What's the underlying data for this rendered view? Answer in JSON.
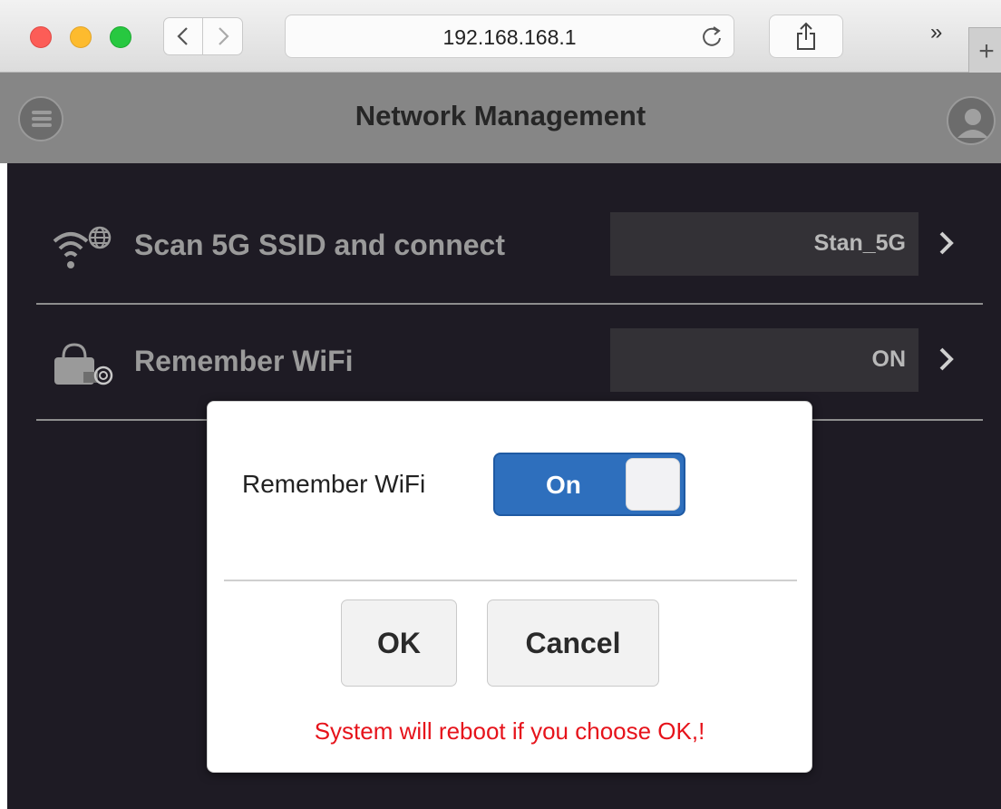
{
  "browser": {
    "url": "192.168.168.1",
    "overflow_label": "»",
    "new_tab_label": "+"
  },
  "app": {
    "title": "Network Management"
  },
  "rows": [
    {
      "label": "Scan 5G SSID and connect",
      "value": "Stan_5G",
      "icon": "wifi-globe-icon"
    },
    {
      "label": "Remember WiFi",
      "value": "ON",
      "icon": "wifi-lock-icon"
    }
  ],
  "dialog": {
    "label": "Remember WiFi",
    "toggle_text": "On",
    "toggle_state": true,
    "ok_label": "OK",
    "cancel_label": "Cancel",
    "warning": "System will reboot if you choose OK,!"
  },
  "colors": {
    "accent": "#2e6fbd",
    "warning": "#e6131b",
    "header_bg": "#868686",
    "content_bg": "#1e1b24"
  }
}
